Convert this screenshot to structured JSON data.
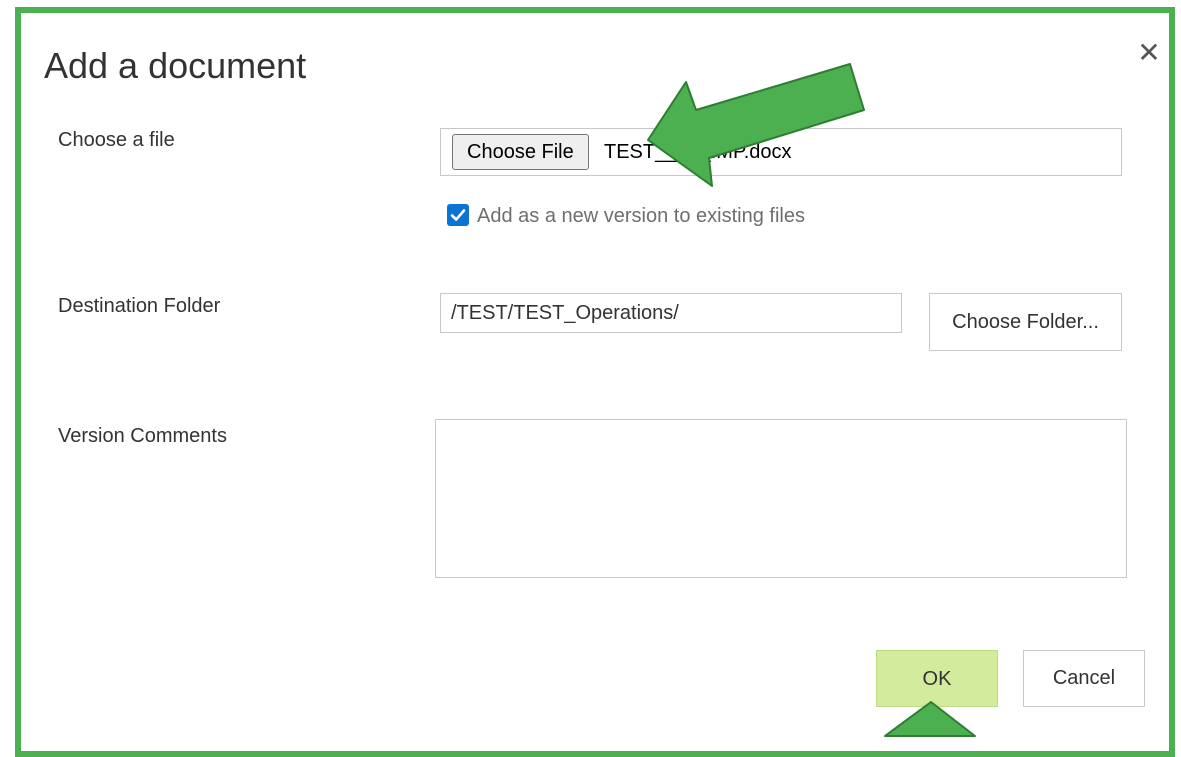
{
  "dialog": {
    "title": "Add a document",
    "close_glyph": "✕"
  },
  "fields": {
    "choose_file_label": "Choose a file",
    "choose_file_button": "Choose File",
    "file_name": "TEST_____IMP.docx",
    "add_version_checked": true,
    "add_version_label": "Add as a new version to existing files",
    "destination_label": "Destination Folder",
    "destination_value": "/TEST/TEST_Operations/",
    "choose_folder_button": "Choose Folder...",
    "version_comments_label": "Version Comments",
    "version_comments_value": ""
  },
  "actions": {
    "ok": "OK",
    "cancel": "Cancel"
  },
  "annotation": {
    "arrow_color": "#4caf50",
    "border_color": "#4caf50"
  },
  "icons": {
    "close": "close-icon",
    "checkbox": "checkmark-icon",
    "resize": "resize-grip-icon",
    "arrow_file": "arrow-annotation-icon",
    "arrow_ok": "arrow-annotation-icon"
  }
}
